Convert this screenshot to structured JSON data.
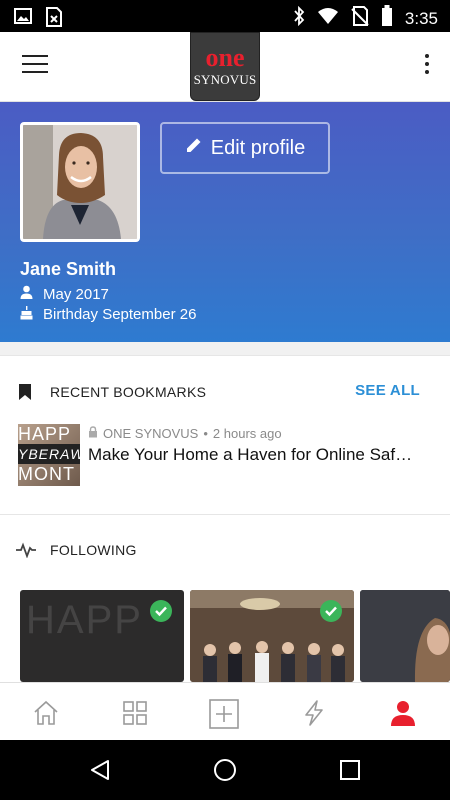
{
  "status_bar": {
    "time": "3:35",
    "icons": [
      "image-icon",
      "file-x-icon",
      "bluetooth-icon",
      "wifi-icon",
      "no-sim-icon",
      "battery-icon"
    ]
  },
  "app_bar": {
    "logo_top": "one",
    "logo_bottom": "SYNOVUS",
    "icons": [
      "menu-icon",
      "more-vert-icon"
    ]
  },
  "profile": {
    "edit_label": "Edit profile",
    "name": "Jane Smith",
    "joined": "May 2017",
    "birthday": "Birthday September 26"
  },
  "bookmarks": {
    "header": "RECENT BOOKMARKS",
    "see_all": "SEE ALL",
    "item": {
      "source": "ONE SYNOVUS",
      "time": "2 hours ago",
      "title": "Make Your Home a Haven for Online Saf…",
      "thumb_lines": [
        "HAPP",
        "YBERAW",
        "MONT"
      ]
    }
  },
  "following": {
    "header": "FOLLOWING",
    "card1_text": "HAPP"
  },
  "bottom_nav": {
    "items": [
      "home-icon",
      "grid-icon",
      "add-box-icon",
      "lightning-icon",
      "profile-icon"
    ],
    "active_color": "#e8202e"
  },
  "colors": {
    "accent_link": "#2c8fd6",
    "header_gradient_top": "#4b5cc4",
    "header_gradient_bottom": "#2e7bd0",
    "check_green": "#3bb55a"
  }
}
